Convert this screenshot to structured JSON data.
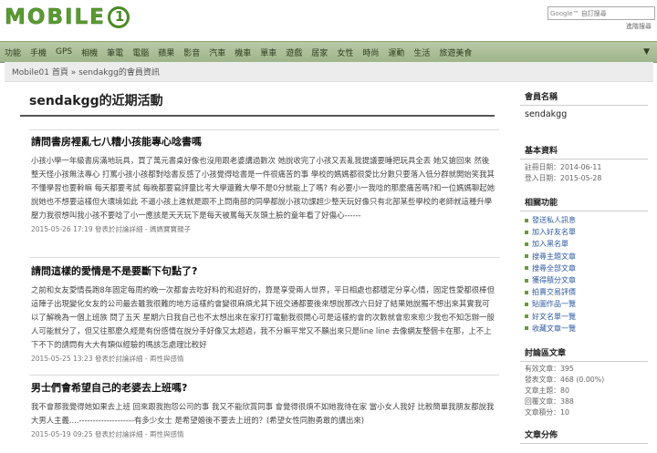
{
  "header": {
    "logo_text": "MOBILE",
    "logo_badge": "1",
    "search_brand": "Google™",
    "search_placeholder": "自訂搜尋",
    "advanced_search": "進階搜尋"
  },
  "nav": {
    "items": [
      "功能",
      "手機",
      "GPS",
      "相機",
      "筆電",
      "電腦",
      "蘋果",
      "影音",
      "汽車",
      "機車",
      "單車",
      "遊戲",
      "居家",
      "女性",
      "時尚",
      "運動",
      "生活",
      "旅遊美食"
    ],
    "more_icon": "caret-down"
  },
  "breadcrumb": "Mobile01 首頁 » sendakgg的會員資訊",
  "main": {
    "title": "sendakgg的近期活動",
    "posts": [
      {
        "title": "請問書房裡亂七八糟小孩能專心唸書嗎",
        "body": "小孩小學一年級書房滿地玩具，買了萬元書桌好像也沒用跟老婆講過數次 她說收完了小孩又丟亂我提議要睡把玩具全丟 她又搶回來 然後整天怪小孩無法專心 打罵小孩小孩都對唸書反感了小孩覺得唸書是一件很痛苦的事 學校的媽媽都很愛比分數只要落入低分群就開始笑我其不懂學習也要幹嘛 每天都要考試 每晚都要寫評量比考大學還難大學不是0分就能上了嗎? 有必要小一我唸的那麼痛苦嗎?和一位媽媽聊起她說她也不想要這樣但大環境如此 不逼小孩上進就是跟不上問南部的同學都說小孩功課超少整天玩好像只有北部某些學校的老師就這種升學壓力我很想叫我小孩不要唸了小一應該是天天玩下是每天被罵每天灰頭土臉的童年看了好傷心------",
        "meta": "2015-05-26 17:19 發表於討論詳細 - 媽媽寶寶親子"
      },
      {
        "title": "請問這樣的愛情是不是要斷下句點了?",
        "body": "之前和女友愛情長跑8年固定每周約晚一次都會去吃好料的和逛好的，算是享受兩人世界，平日相處也都穩定分享心情，固定性愛都很棒但這陣子出現變化女友的公司最去雖我很難的地方這樣約會變很麻煩尤其下班交通都要後來想說那改六日好了結果她說獨不想出來其實我可以了解晚為一個上班族 問了五天 星期六日我自己也不太想出來在家打打電動我很開心可是這樣約會的次數就會愈來愈少我也不知怎辦一般人可能就分了，但又往那麼久經是有份感情在說分手好像又太超過，我不分嘛平常又不願出來只是line line 去像網友整個卡在那，上不上 下不下的請問有大大有類似經驗的嗎該怎處理比較好",
        "meta": "2015-05-25 13:23 發表於討論詳細 - 兩性與感情"
      },
      {
        "title": "男士們會希望自己的老婆去上班嗎?",
        "body": "我不會那我覺得她如果去上班 回來跟我抱怨公司的事 我又不能欣賞同事 會覺得很煩不如她我待在家 當小女人我好 比較簡單我朋友都說我大男人主義....--------------------有多少女士 是希望婚後不要去上班的？(希望女性同胞勇敢的講出來)",
        "meta": "2015-05-19 09:25 發表於討論詳細 - 兩性與感情"
      }
    ]
  },
  "sidebar": {
    "member_label": "會員名稱",
    "member_name": "sendakgg",
    "basic_label": "基本資料",
    "register_date": "註冊日期：2014-06-11",
    "login_date": "登入日期：2015-05-28",
    "functions_label": "相關功能",
    "functions": [
      "發送私人訊息",
      "加入好友名單",
      "加入黑名單",
      "搜尋主題文章",
      "搜尋全部文章",
      "獲得積分文章",
      "拍賣交易評價",
      "貼圖作品一覽",
      "好文名單一覽",
      "收藏文章一覽"
    ],
    "stats_label": "討論區文章",
    "stats": [
      "有效文章：395",
      "發表文章：468 (0.00%)",
      "文章主題：80",
      "回覆文章：388",
      "文章積分：10"
    ],
    "dist_label": "文章分佈"
  }
}
